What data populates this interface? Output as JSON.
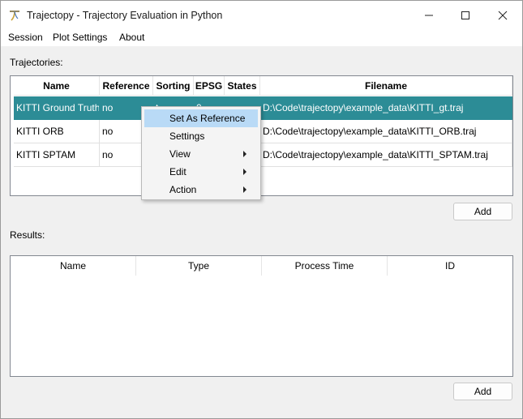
{
  "window": {
    "title": "Trajectopy - Trajectory Evaluation in Python",
    "icon": "trajectopy-logo-icon"
  },
  "menu": {
    "items": [
      "Session",
      "Plot Settings",
      "About"
    ]
  },
  "trajectories": {
    "label": "Trajectories:",
    "columns": [
      "Name",
      "Reference",
      "Sorting",
      "EPSG",
      "States",
      "Filename"
    ],
    "rows": [
      {
        "name": "KITTI Ground Truth",
        "reference": "no",
        "sorting": "t",
        "epsg": "0",
        "states": "",
        "filename": "D:\\Code\\trajectopy\\example_data\\KITTI_gt.traj",
        "selected": true
      },
      {
        "name": "KITTI ORB",
        "reference": "no",
        "sorting": "",
        "epsg": "",
        "states": "",
        "filename": "D:\\Code\\trajectopy\\example_data\\KITTI_ORB.traj",
        "selected": false
      },
      {
        "name": "KITTI SPTAM",
        "reference": "no",
        "sorting": "",
        "epsg": "",
        "states": "",
        "filename": "D:\\Code\\trajectopy\\example_data\\KITTI_SPTAM.traj",
        "selected": false
      }
    ],
    "add_label": "Add",
    "selection_color": "#2c8c96"
  },
  "context_menu": {
    "items": [
      {
        "label": "Set As Reference",
        "submenu": false,
        "highlighted": true
      },
      {
        "label": "Settings",
        "submenu": false,
        "highlighted": false
      },
      {
        "label": "View",
        "submenu": true,
        "highlighted": false
      },
      {
        "label": "Edit",
        "submenu": true,
        "highlighted": false
      },
      {
        "label": "Action",
        "submenu": true,
        "highlighted": false
      }
    ],
    "highlight_color": "#b9daf6"
  },
  "results": {
    "label": "Results:",
    "columns": [
      "Name",
      "Type",
      "Process Time",
      "ID"
    ],
    "add_label": "Add"
  }
}
